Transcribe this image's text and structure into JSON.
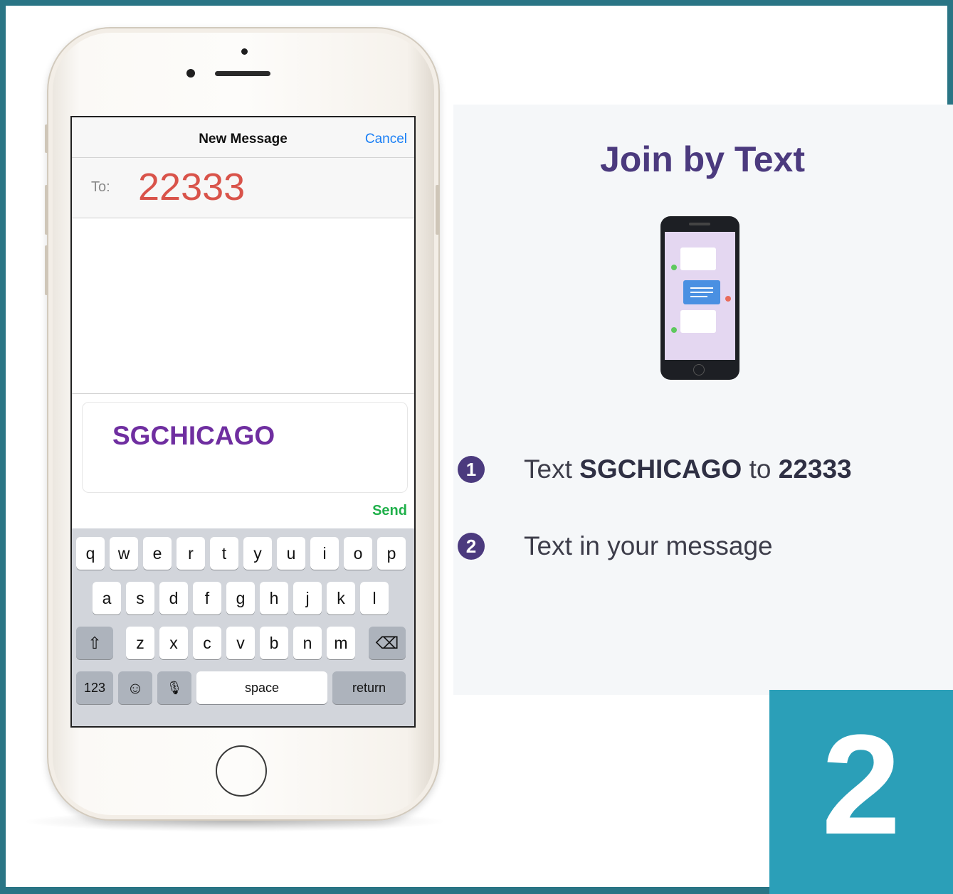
{
  "messages": {
    "nav": {
      "title": "New Message",
      "cancel": "Cancel"
    },
    "to": {
      "label": "To:",
      "value": "22333"
    },
    "compose_text": "SGCHICAGO",
    "send": "Send"
  },
  "keyboard": {
    "row1": [
      "q",
      "w",
      "e",
      "r",
      "t",
      "y",
      "u",
      "i",
      "o",
      "p"
    ],
    "row2": [
      "a",
      "s",
      "d",
      "f",
      "g",
      "h",
      "j",
      "k",
      "l"
    ],
    "row3": [
      "z",
      "x",
      "c",
      "v",
      "b",
      "n",
      "m"
    ],
    "shift_icon": "⇧",
    "delete_icon": "⌫",
    "numbers": "123",
    "emoji_icon": "☺",
    "mic_icon": "🎙",
    "space": "space",
    "return": "return"
  },
  "card": {
    "title": "Join by Text",
    "steps": [
      {
        "number": "1",
        "pre": "Text ",
        "bold1": "SGCHICAGO",
        "mid": " to ",
        "bold2": "22333"
      },
      {
        "number": "2",
        "text": "Text in your message"
      }
    ]
  },
  "tile": {
    "number": "2"
  },
  "colors": {
    "frame": "#2a7585",
    "tile": "#2b9fb8",
    "title_purple": "#4b3a7e",
    "compose_purple": "#6f2ea0",
    "to_red": "#d9534a",
    "ios_blue": "#1a7ff5",
    "send_green": "#1fb04a"
  }
}
